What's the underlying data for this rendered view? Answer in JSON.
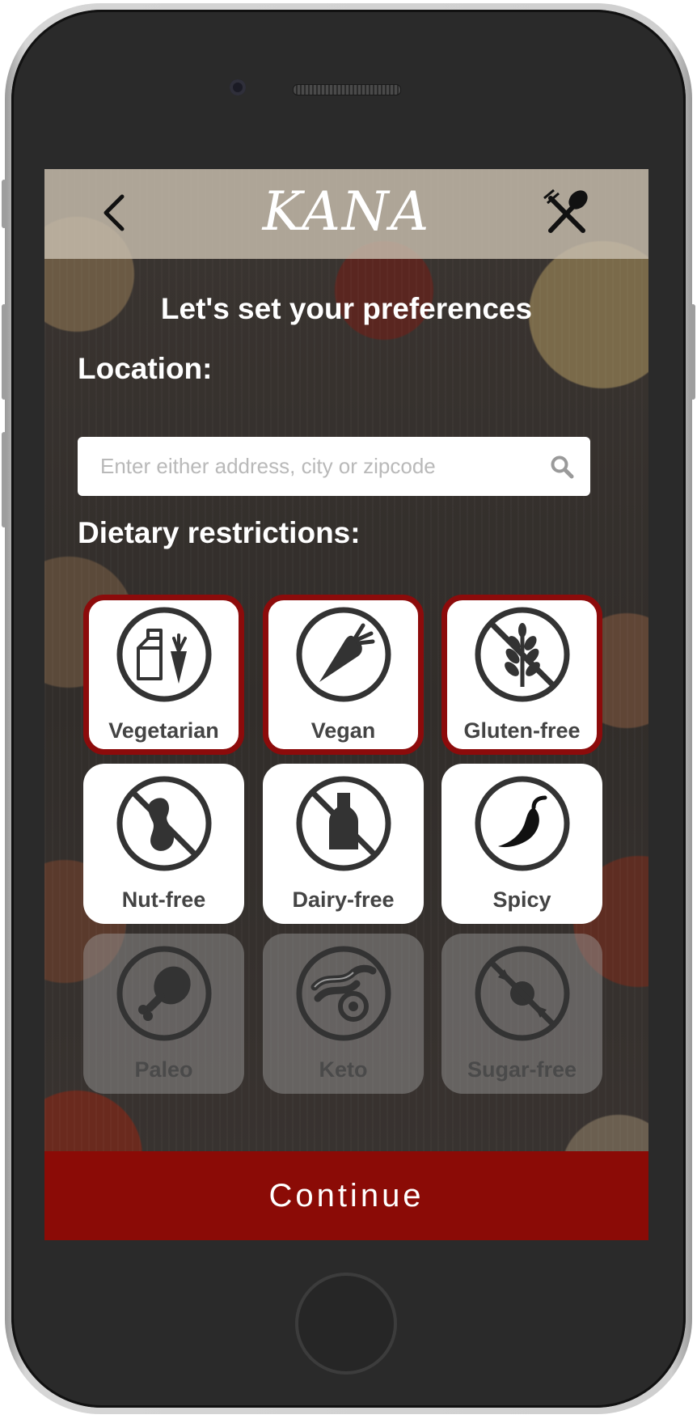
{
  "header": {
    "logo": "KANA",
    "back_icon": "chevron-left-icon",
    "menu_icon": "fork-knife-crossed-icon"
  },
  "page": {
    "title": "Let's set your preferences"
  },
  "location": {
    "label": "Location:",
    "placeholder": "Enter either address, city or zipcode",
    "value": ""
  },
  "dietary": {
    "label": "Dietary restrictions:",
    "options": [
      {
        "label": "Vegetarian",
        "icon": "milk-carrot-icon",
        "state": "selected"
      },
      {
        "label": "Vegan",
        "icon": "carrot-icon",
        "state": "selected"
      },
      {
        "label": "Gluten-free",
        "icon": "no-wheat-icon",
        "state": "selected"
      },
      {
        "label": "Nut-free",
        "icon": "no-peanut-icon",
        "state": "default"
      },
      {
        "label": "Dairy-free",
        "icon": "no-milk-bottle-icon",
        "state": "default"
      },
      {
        "label": "Spicy",
        "icon": "chili-pepper-icon",
        "state": "default"
      },
      {
        "label": "Paleo",
        "icon": "drumstick-icon",
        "state": "disabled"
      },
      {
        "label": "Keto",
        "icon": "bacon-egg-icon",
        "state": "disabled"
      },
      {
        "label": "Sugar-free",
        "icon": "no-candy-icon",
        "state": "disabled"
      }
    ]
  },
  "continue_label": "Continue",
  "colors": {
    "accent": "#8b0b06",
    "selected_border": "#8c0b0b",
    "icon": "#333333"
  }
}
